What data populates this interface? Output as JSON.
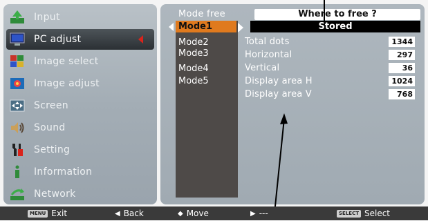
{
  "menu": {
    "items": [
      {
        "label": "Input",
        "icon": "input-icon"
      },
      {
        "label": "PC adjust",
        "icon": "pc-adjust-icon",
        "active": true
      },
      {
        "label": "Image select",
        "icon": "image-select-icon"
      },
      {
        "label": "Image adjust",
        "icon": "image-adjust-icon"
      },
      {
        "label": "Screen",
        "icon": "screen-icon"
      },
      {
        "label": "Sound",
        "icon": "sound-icon"
      },
      {
        "label": "Setting",
        "icon": "setting-icon"
      },
      {
        "label": "Information",
        "icon": "information-icon"
      },
      {
        "label": "Network",
        "icon": "network-icon"
      }
    ]
  },
  "submenu": {
    "mode_free_label": "Mode free",
    "where_text": "Where to free ?",
    "modes": [
      "Mode1",
      "Mode2",
      "Mode3",
      "Mode4",
      "Mode5"
    ],
    "selected_mode": "Mode1",
    "stored_label": "Stored",
    "info": [
      {
        "label": "Total dots",
        "value": "1344"
      },
      {
        "label": "Horizontal",
        "value": "297"
      },
      {
        "label": "Vertical",
        "value": "36"
      },
      {
        "label": "Display area H",
        "value": "1024"
      },
      {
        "label": "Display area V",
        "value": "768"
      }
    ]
  },
  "bottom": {
    "exit_key": "MENU",
    "exit_label": "Exit",
    "back_label": "Back",
    "move_label": "Move",
    "next_label": "---",
    "select_key": "SELECT",
    "select_label": "Select"
  },
  "colors": {
    "accent_orange": "#e07a1e",
    "active_arrow_red": "#d9241c"
  }
}
